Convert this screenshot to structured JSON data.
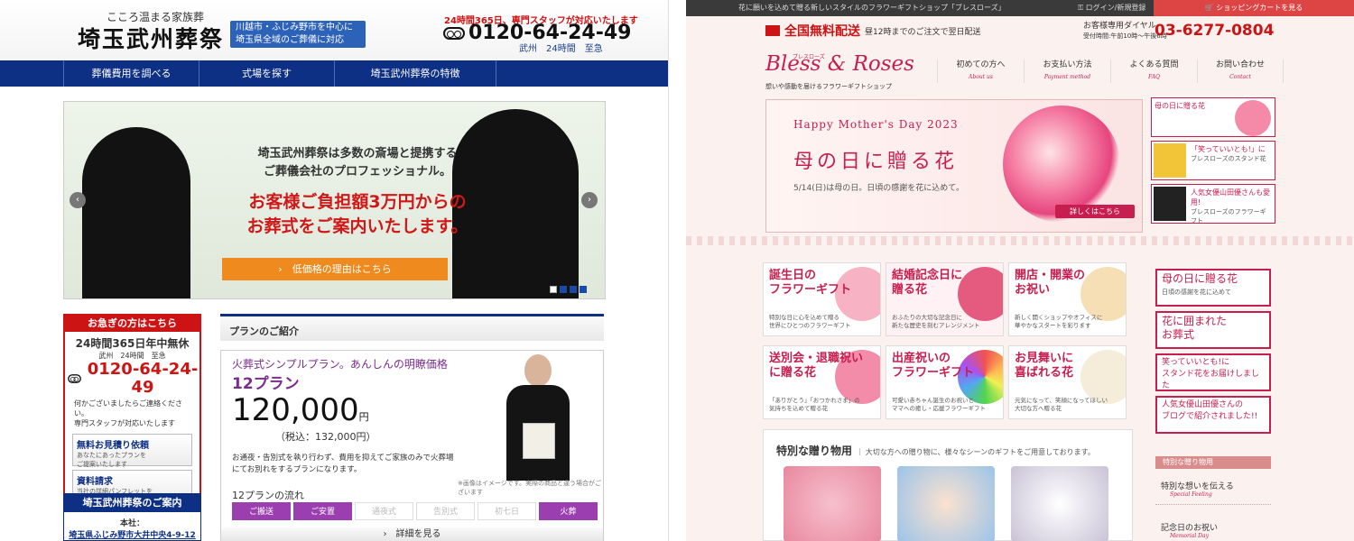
{
  "left": {
    "tagline": "こころ温まる家族葬",
    "logo": "埼玉武州葬祭",
    "area_badge": "川越市・ふじみ野市を中心に\n埼玉県全域のご葬儀に対応",
    "hours_notice": "24時間365日、専門スタッフが対応いたします",
    "phone": "0120-64-24-49",
    "phone_sub": "武州　24時間　至急",
    "nav": [
      "葬儀費用を調べる",
      "式場を探す",
      "埼玉武州葬祭の特徴"
    ],
    "hero": {
      "line1": "埼玉武州葬祭は多数の斎場と提携する\nご葬儀会社のプロフェッショナル。",
      "line2": "お客様ご負担額3万円からの\nお葬式をご案内いたします。",
      "cta": "›　低価格の理由はこちら"
    },
    "urgent": {
      "header": "お急ぎの方はこちら",
      "title": "24時間365日年中無休",
      "small": "武州　24時間　至急",
      "phone": "0120-64-24-49",
      "note": "何かございましたらご連絡ください。\n専門スタッフが対応いたします",
      "btn1_title": "無料お見積り依頼",
      "btn1_sub": "あなたにあったプランを\nご提案いたします",
      "btn2_title": "資料請求",
      "btn2_sub": "当社の詳細パンフレットを\n即日発送いたします"
    },
    "info": {
      "header": "埼玉武州葬祭のご案内",
      "address_label": "本社：",
      "address": "埼玉県ふじみ野市大井中央4-9-12"
    },
    "plan": {
      "section_title": "プランのご紹介",
      "catch": "火葬式シンプルプラン。あんしんの明瞭価格",
      "plan_name": "12プラン",
      "price": "120,000",
      "yen": "円",
      "tax": "（税込：132,000円）",
      "desc": "お通夜・告別式を執り行わず、費用を抑えてご家族のみで火葬場にてお別れをするプランになります。",
      "image_note": "※画像はイメージです。実際の商品と違う場合がございます",
      "flow_title": "12プランの流れ",
      "flow": [
        "ご搬送",
        "ご安置",
        "通夜式",
        "告別式",
        "初七日",
        "火葬"
      ],
      "more": "›　詳細を見る"
    }
  },
  "right": {
    "topbar_text": "花に願いを込めて贈る新しいスタイルのフラワーギフトショップ「ブレスローズ」",
    "login": "ログイン/新規登録",
    "cart": "ショッピングカートを見る",
    "free_shipping": "全国無料配送",
    "free_shipping_sub": "昼12時までのご注文で翌日配送",
    "dial_label": "お客様専用ダイヤル",
    "dial_hours": "受付時間:午前10時〜午後6時",
    "dial_number": "03-6277-0804",
    "brand_kana": "ブレスローズ",
    "brand": "Bless & Roses",
    "brand_sub": "想いや感動を届けるフラワーギフトショップ",
    "nav": [
      {
        "label": "初めての方へ",
        "en": "About us"
      },
      {
        "label": "お支払い方法",
        "en": "Payment method"
      },
      {
        "label": "よくある質問",
        "en": "FAQ"
      },
      {
        "label": "お問い合わせ",
        "en": "Contact"
      }
    ],
    "mothers_day": {
      "en_title": "Happy Mother's Day 2023",
      "title": "母の日に贈る花",
      "sub": "5/14(日)は母の日。日頃の感謝を花に込めて。",
      "button": "詳しくはこちら"
    },
    "thumbs": [
      {
        "title": "母の日に贈る花",
        "sub": ""
      },
      {
        "title": "「笑っていいとも!」に",
        "sub": "ブレスローズのスタンド花"
      },
      {
        "title": "人気女優山田優さんも愛用!",
        "sub": "ブレスローズのフラワーギフト"
      }
    ],
    "tiles": [
      {
        "title": "誕生日の\nフラワーギフト",
        "sub": "特別な日に心を込めて贈る\n世界にひとつのフラワーギフト"
      },
      {
        "title": "結婚記念日に\n贈る花",
        "sub": "おふたりの大切な記念日に\n新たな歴史を刻むアレンジメント"
      },
      {
        "title": "開店・開業の\nお祝い",
        "sub": "新しく開くショップやオフィスに\n華やかなスタートを彩ります"
      },
      {
        "title": "送別会・退職祝い\nに贈る花",
        "sub": "「ありがとう」「おつかれさま」の\n気持ちを込めて贈る花"
      },
      {
        "title": "出産祝いの\nフラワーギフト",
        "sub": "可愛い赤ちゃん誕生のお祝いと\nママへの癒し・応援フラワーギフト"
      },
      {
        "title": "お見舞いに\n喜ばれる花",
        "sub": "元気になって、笑顔になってほしい\n大切な方へ贈る花"
      }
    ],
    "special": {
      "title": "特別な贈り物用",
      "sub": "｜ 大切な方への贈り物に、様々なシーンのギフトをご用意しております。"
    },
    "side_banners": [
      {
        "title": "母の日に贈る花",
        "sub": "日頃の感謝を花に込めて"
      },
      {
        "title": "花に囲まれた\nお葬式",
        "sub": ""
      },
      {
        "title": "笑っていいとも!に\nスタンド花をお届けしました",
        "sub": ""
      },
      {
        "title": "人気女優山田優さんの\nブログで紹介されました!!",
        "sub": ""
      }
    ],
    "side_section": "特別な贈り物用",
    "side_items": [
      {
        "label": "特別な想いを伝える",
        "en": "Special Feeling"
      },
      {
        "label": "記念日のお祝い",
        "en": "Memorial Day"
      }
    ],
    "colors": {
      "brand": "#c61e4e",
      "left_nav": "#0d2f84",
      "accent_red": "#cc1414"
    }
  }
}
